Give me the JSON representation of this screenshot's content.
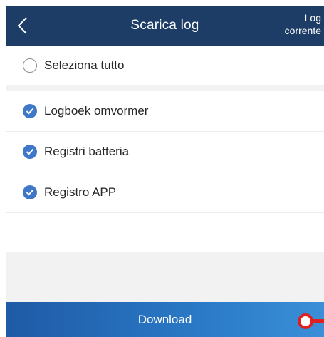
{
  "header": {
    "title": "Scarica log",
    "current_log_line1": "Log",
    "current_log_line2": "corrente"
  },
  "select_all": {
    "label": "Seleziona tutto",
    "checked": false
  },
  "items": [
    {
      "label": "Logboek omvormer",
      "checked": true
    },
    {
      "label": "Registri batteria",
      "checked": true
    },
    {
      "label": "Registro APP",
      "checked": true
    }
  ],
  "footer": {
    "download_label": "Download"
  },
  "colors": {
    "header_bg": "#1d3d67",
    "check_blue": "#3f78c9",
    "button_blue": "#2a79c6",
    "marker_red": "#e02020"
  }
}
